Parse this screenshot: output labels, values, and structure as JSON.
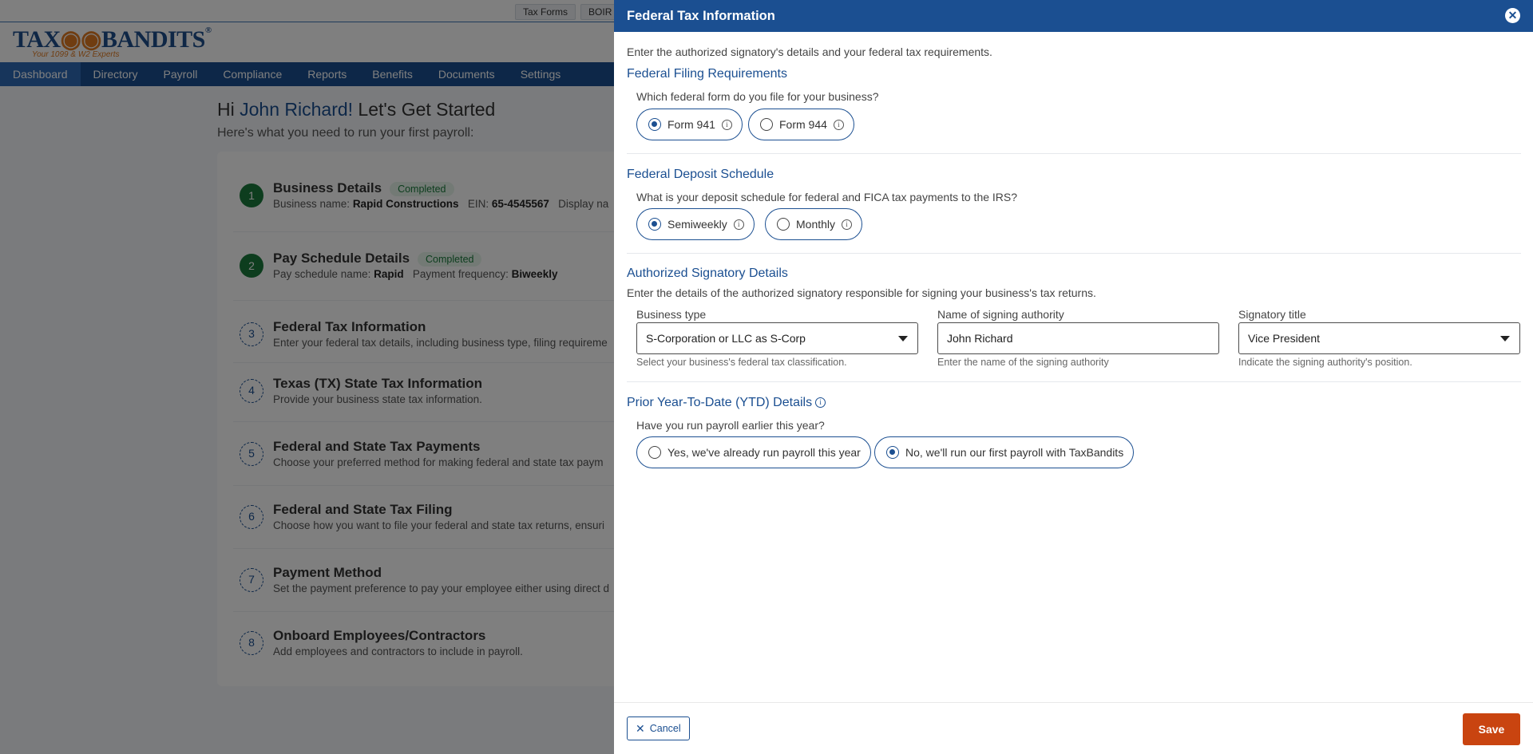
{
  "background": {
    "top_links": [
      "Tax Forms",
      "BOIR"
    ],
    "logo": {
      "text_a": "TAX",
      "text_b": "BANDITS",
      "reg": "®",
      "tagline": "Your 1099 & W2 Experts"
    },
    "nav": [
      "Dashboard",
      "Directory",
      "Payroll",
      "Compliance",
      "Reports",
      "Benefits",
      "Documents",
      "Settings"
    ],
    "greeting_prefix": "Hi ",
    "greeting_name": "John Richard!",
    "greeting_suffix": " Let's Get Started",
    "subheading": "Here's what you need to run your first payroll:",
    "steps": [
      {
        "num": "1",
        "title": "Business Details",
        "badge": "Completed",
        "desc_parts": [
          "Business name: ",
          "Rapid Constructions",
          "   EIN: ",
          "65-4545567",
          "   Display na"
        ]
      },
      {
        "num": "2",
        "title": "Pay Schedule Details",
        "badge": "Completed",
        "desc_parts": [
          "Pay schedule name: ",
          "Rapid",
          "   Payment frequency: ",
          "Biweekly",
          ""
        ]
      },
      {
        "num": "3",
        "title": "Federal Tax Information",
        "desc": "Enter your federal tax details, including business type, filing requireme"
      },
      {
        "num": "4",
        "title": "Texas (TX) State Tax Information",
        "desc": "Provide your business state tax information."
      },
      {
        "num": "5",
        "title": "Federal and State Tax Payments",
        "desc": "Choose your preferred method for making federal and state tax paym"
      },
      {
        "num": "6",
        "title": "Federal and State Tax Filing",
        "desc": "Choose how you want to file your federal and state tax returns, ensuri"
      },
      {
        "num": "7",
        "title": "Payment Method",
        "desc": "Set the payment preference to pay your employee either using direct d"
      },
      {
        "num": "8",
        "title": "Onboard Employees/Contractors",
        "desc": "Add employees and contractors to include in payroll."
      }
    ]
  },
  "drawer": {
    "title": "Federal Tax Information",
    "intro": "Enter the authorized signatory's details and your federal tax requirements.",
    "filing": {
      "title": "Federal Filing Requirements",
      "question": "Which federal form do you file for your business?",
      "options": [
        "Form 941",
        "Form 944"
      ],
      "selected": "Form 941"
    },
    "deposit": {
      "title": "Federal Deposit Schedule",
      "question": "What is your deposit schedule for federal and FICA tax payments to the IRS?",
      "options": [
        "Semiweekly",
        "Monthly"
      ],
      "selected": "Semiweekly"
    },
    "signatory": {
      "title": "Authorized Signatory Details",
      "desc": "Enter the details of the authorized signatory responsible for signing your business's tax returns.",
      "business_type": {
        "label": "Business type",
        "value": "S-Corporation or LLC as S-Corp",
        "helper": "Select your business's federal tax classification."
      },
      "signing_name": {
        "label": "Name of signing authority",
        "value": "John Richard",
        "helper": "Enter the name of the signing authority"
      },
      "signatory_title": {
        "label": "Signatory title",
        "value": "Vice President",
        "helper": "Indicate the signing authority's position."
      }
    },
    "ytd": {
      "title": "Prior Year-To-Date (YTD) Details",
      "question": "Have you run payroll earlier this year?",
      "options": [
        "Yes, we've already run payroll this year",
        "No, we'll run our first payroll with TaxBandits"
      ],
      "selected": "No, we'll run our first payroll with TaxBandits"
    },
    "footer": {
      "cancel": "Cancel",
      "save": "Save"
    }
  },
  "colors": {
    "primary": "#1b4f91",
    "save": "#c94410",
    "completed": "#1b7a3c"
  }
}
